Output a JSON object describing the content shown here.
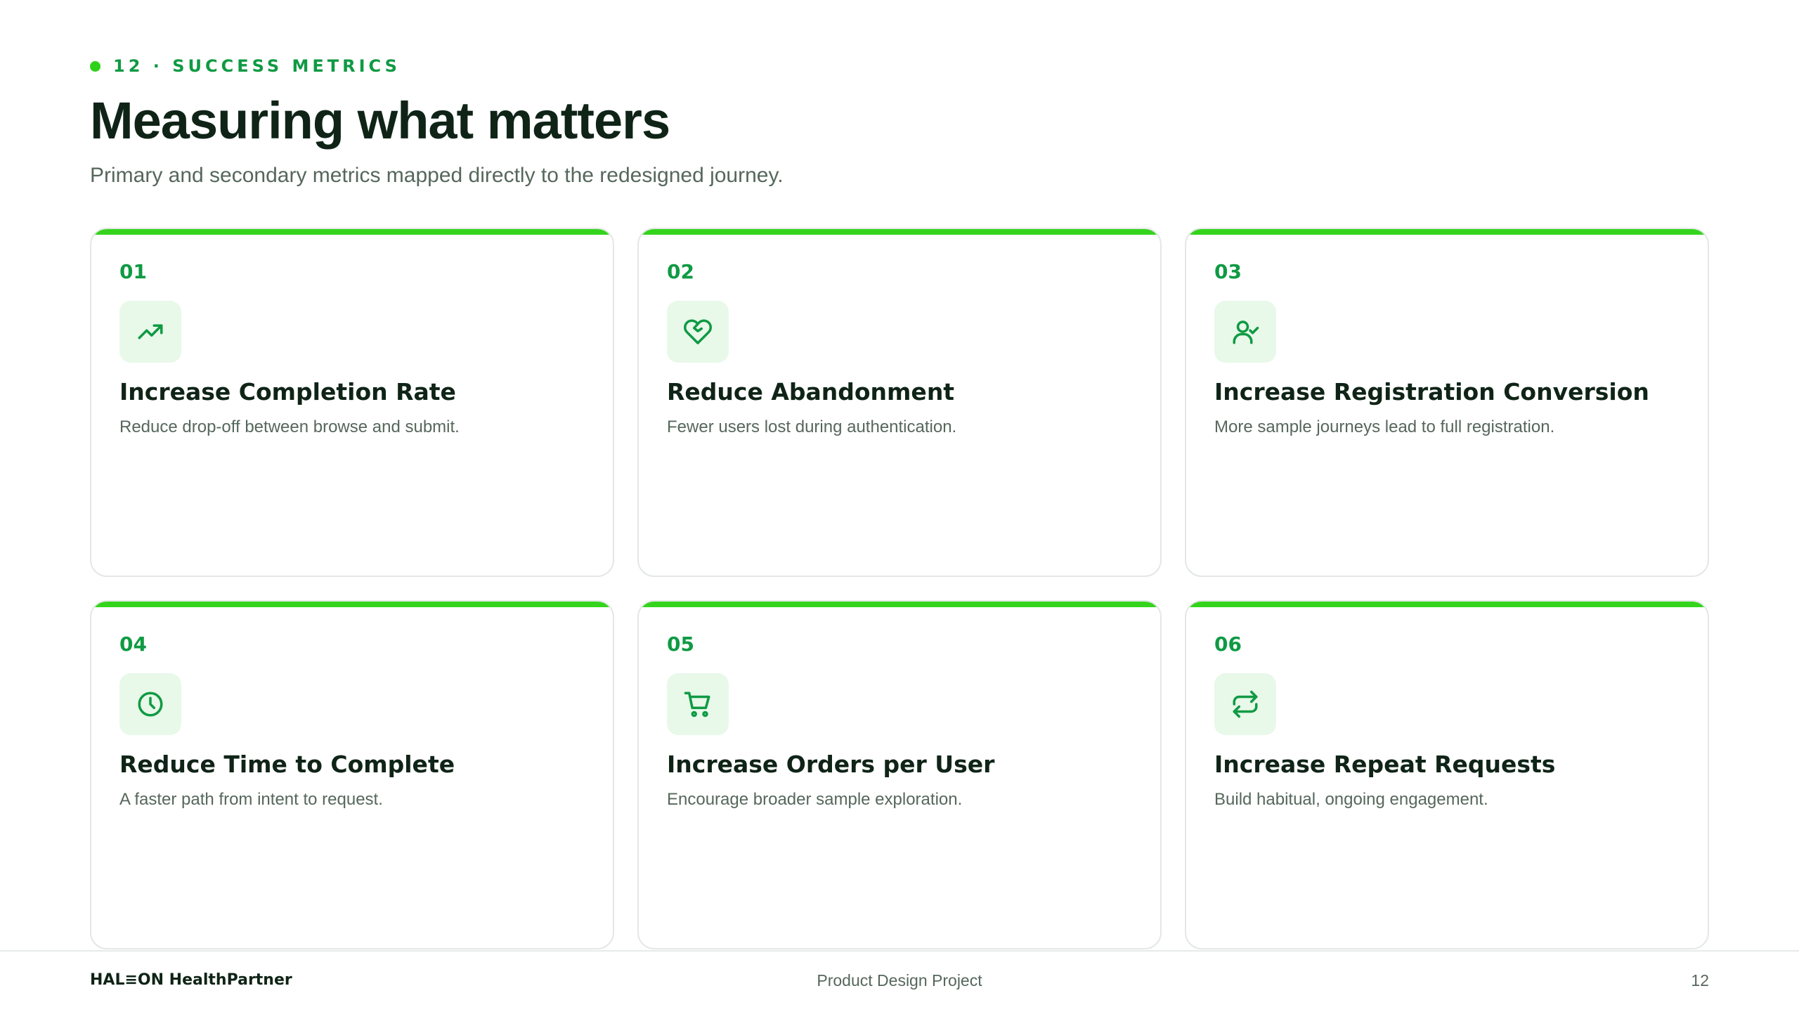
{
  "header": {
    "eyebrow": "12 · SUCCESS METRICS",
    "title": "Measuring what matters",
    "subtitle": "Primary and secondary metrics mapped directly to the redesigned journey."
  },
  "cards": [
    {
      "number": "01",
      "icon": "trending-up-icon",
      "title": "Increase Completion Rate",
      "description": "Reduce drop-off between browse and submit."
    },
    {
      "number": "02",
      "icon": "heart-icon",
      "title": "Reduce Abandonment",
      "description": "Fewer users lost during authentication."
    },
    {
      "number": "03",
      "icon": "user-check-icon",
      "title": "Increase Registration Conversion",
      "description": "More sample journeys lead to full registration."
    },
    {
      "number": "04",
      "icon": "clock-icon",
      "title": "Reduce Time to Complete",
      "description": "A faster path from intent to request."
    },
    {
      "number": "05",
      "icon": "cart-icon",
      "title": "Increase Orders per User",
      "description": "Encourage broader sample exploration."
    },
    {
      "number": "06",
      "icon": "repeat-icon",
      "title": "Increase Repeat Requests",
      "description": "Build habitual, ongoing engagement."
    }
  ],
  "footer": {
    "brand": "HAL≡ON HealthPartner",
    "center": "Product Design Project",
    "page": "12"
  },
  "colors": {
    "accent": "#34d41c",
    "accent_dark": "#0f9a43",
    "icon_bg": "#e8f8e9",
    "heading": "#0f2417",
    "muted": "#56675c"
  }
}
